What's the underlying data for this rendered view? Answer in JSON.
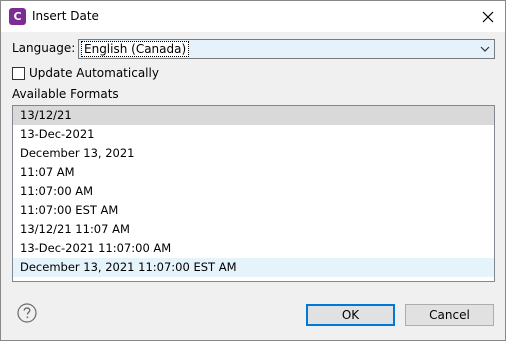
{
  "window": {
    "title": "Insert Date",
    "app_icon_letter": "C"
  },
  "language": {
    "label": "Language:",
    "selected": "English (Canada)"
  },
  "update_automatically": {
    "label": "Update Automatically",
    "checked": false
  },
  "formats": {
    "label": "Available Formats",
    "items": [
      "13/12/21",
      "13-Dec-2021",
      "December 13, 2021",
      "11:07 AM",
      "11:07:00 AM",
      "11:07:00 EST AM",
      "13/12/21 11:07 AM",
      "13-Dec-2021 11:07:00 AM",
      "December 13, 2021 11:07:00 EST AM"
    ],
    "selected_index": 0,
    "hover_index": 8
  },
  "buttons": {
    "ok": "OK",
    "cancel": "Cancel"
  },
  "icons": {
    "close": "close-icon",
    "help": "help-icon",
    "dropdown": "chevron-down-icon"
  },
  "colors": {
    "app_icon": "#7b2d91",
    "selection": "#d9d9d9",
    "hover": "#e5f3fb",
    "default_button_border": "#0078d7"
  }
}
